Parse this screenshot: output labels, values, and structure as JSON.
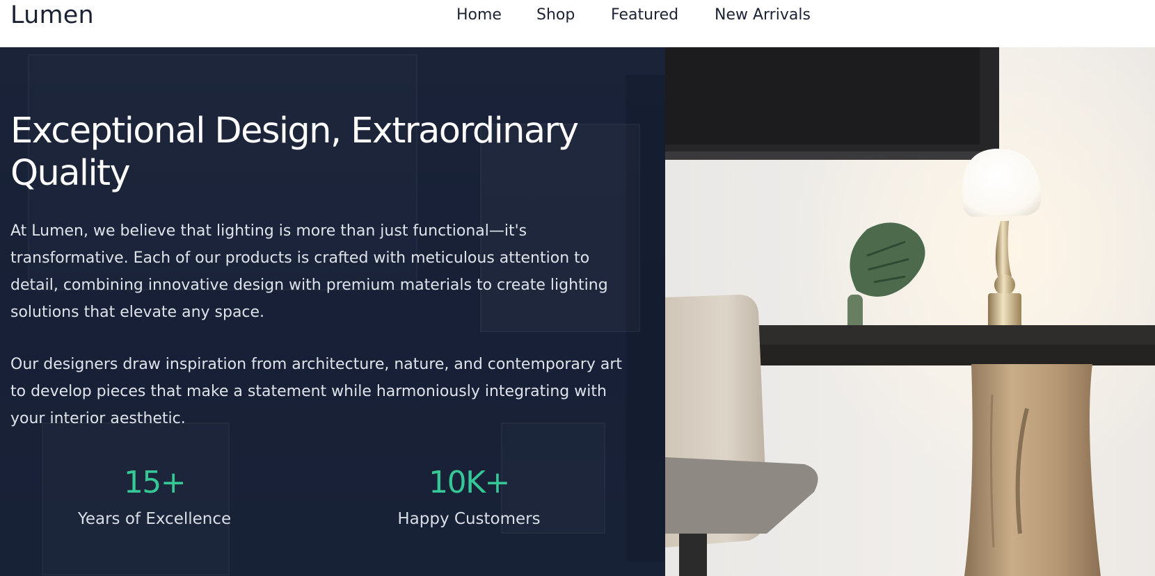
{
  "brand": "Lumen",
  "nav": {
    "home": "Home",
    "shop": "Shop",
    "featured": "Featured",
    "new_arrivals": "New Arrivals"
  },
  "hero": {
    "title": "Exceptional Design, Extraordinary Quality",
    "paragraph_1": "At Lumen, we believe that lighting is more than just functional—it's transformative. Each of our products is crafted with meticulous attention to detail, combining innovative design with premium materials to create lighting solutions that elevate any space.",
    "paragraph_2": "Our designers draw inspiration from architecture, nature, and contemporary art to develop pieces that make a statement while harmoniously integrating with your interior aesthetic.",
    "stats": [
      {
        "value": "15+",
        "label": "Years of Excellence"
      },
      {
        "value": "10K+",
        "label": "Happy Customers"
      }
    ]
  },
  "colors": {
    "accent": "#35c795",
    "hero_bg": "#172036",
    "nav_text": "#1b2233"
  }
}
